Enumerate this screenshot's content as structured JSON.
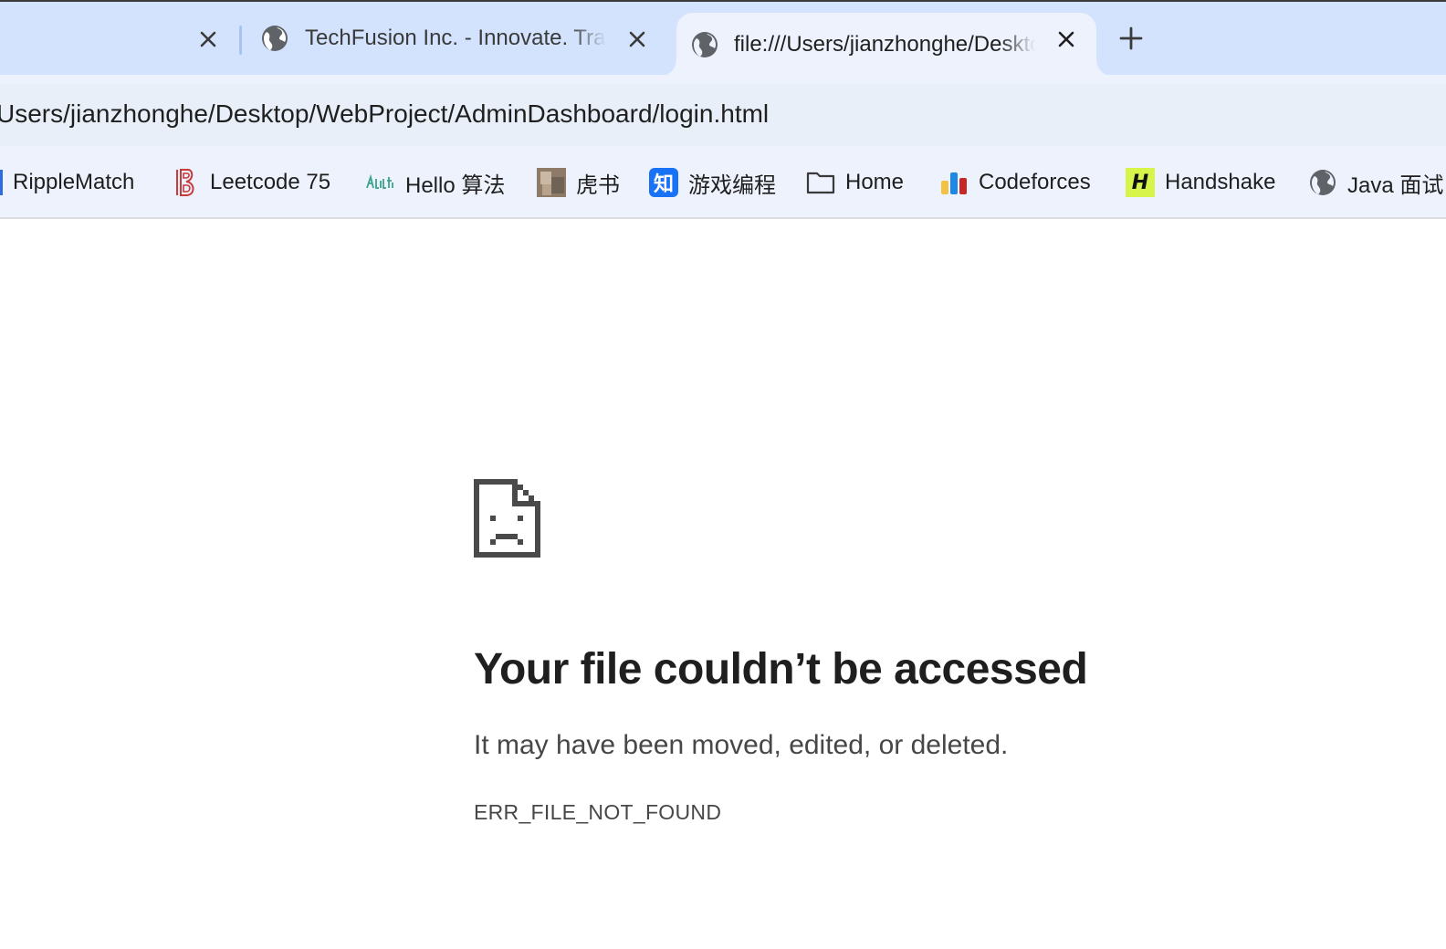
{
  "tabs": [
    {
      "title": "",
      "close_icon": "close-icon"
    },
    {
      "title": "TechFusion Inc. - Innovate. Transform.",
      "favicon": "globe-icon",
      "close_icon": "close-icon"
    },
    {
      "title": "file:///Users/jianzhonghe/Desktop/WebProject/AdminDashboard/login.html",
      "favicon": "globe-icon",
      "close_icon": "close-icon",
      "active": true
    }
  ],
  "new_tab_icon": "plus-icon",
  "address_bar": {
    "url": "Users/jianzhonghe/Desktop/WebProject/AdminDashboard/login.html"
  },
  "bookmarks": [
    {
      "label": "RippleMatch"
    },
    {
      "label": "Leetcode 75",
      "icon": "leetcode-b-icon"
    },
    {
      "label": "Hello 算法",
      "icon": "hello-algo-icon"
    },
    {
      "label": "虎书",
      "icon": "photo-thumbnail-icon"
    },
    {
      "label": "游戏编程",
      "icon": "zhihu-icon",
      "icon_text": "知"
    },
    {
      "label": "Home",
      "icon": "folder-icon"
    },
    {
      "label": "Codeforces",
      "icon": "codeforces-icon"
    },
    {
      "label": "Handshake",
      "icon": "handshake-icon",
      "icon_text": "H"
    },
    {
      "label": "Java 面试",
      "icon": "globe-icon"
    }
  ],
  "error_page": {
    "icon": "sad-file-icon",
    "title": "Your file couldn’t be accessed",
    "subtitle": "It may have been moved, edited, or deleted.",
    "code": "ERR_FILE_NOT_FOUND"
  },
  "colors": {
    "tabstrip": "#d3e3fd",
    "active_tab": "#edf2fc",
    "text": "#1f1f1f",
    "muted_text": "#474747"
  }
}
